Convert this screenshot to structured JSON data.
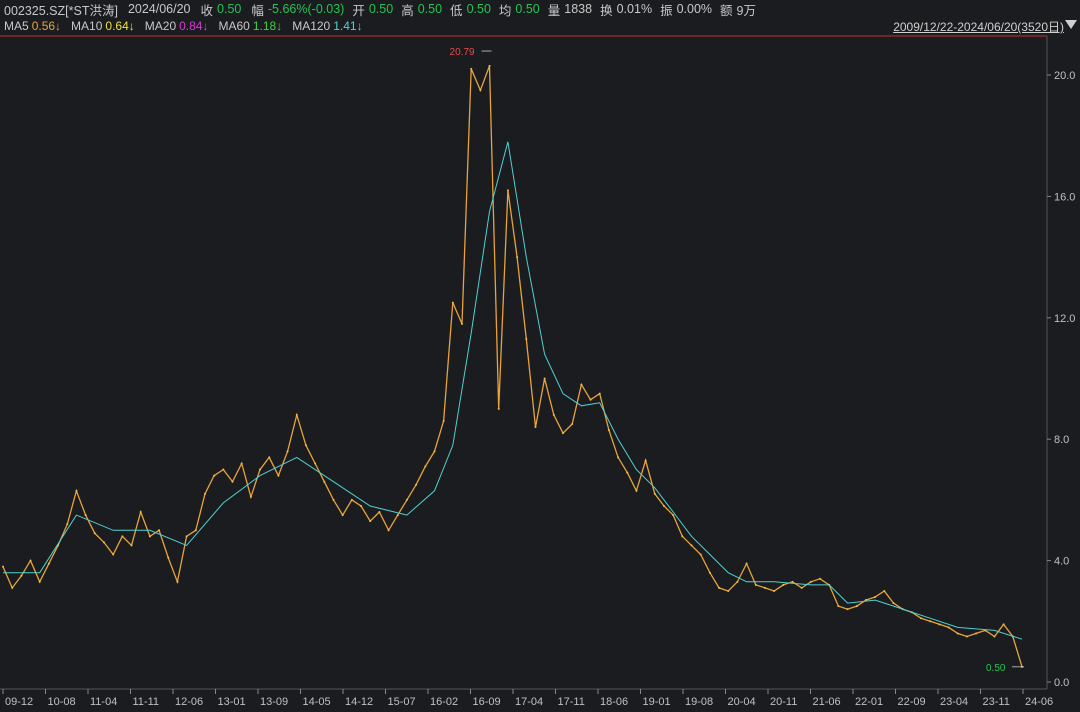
{
  "header": {
    "code": "002325.SZ[*ST洪涛]",
    "date": "2024/06/20",
    "close_label": "收",
    "close_value": "0.50",
    "change_label": "幅",
    "change_value": "-5.66%(-0.03)",
    "open_label": "开",
    "open_value": "0.50",
    "high_label": "高",
    "high_value": "0.50",
    "low_label": "低",
    "low_value": "0.50",
    "avg_label": "均",
    "avg_value": "0.50",
    "volume_label": "量",
    "volume_value": "1838",
    "turnover_label": "换",
    "turnover_value": "0.01%",
    "amplitude_label": "振",
    "amplitude_value": "0.00%",
    "amount_label": "额",
    "amount_value": "9万",
    "range_text": "2009/12/22-2024/06/20(3520日)"
  },
  "ma_legend": [
    {
      "label": "MA5",
      "value": "0.56↓",
      "color": "#e8a33a"
    },
    {
      "label": "MA10",
      "value": "0.64↓",
      "color": "#e8e13a"
    },
    {
      "label": "MA20",
      "value": "0.84↓",
      "color": "#d43bd4"
    },
    {
      "label": "MA60",
      "value": "1.18↓",
      "color": "#3fd13f"
    },
    {
      "label": "MA120",
      "value": "1.41↓",
      "color": "#4fd1d1"
    }
  ],
  "chart_data": {
    "type": "line",
    "title": "",
    "xlabel": "",
    "ylabel": "",
    "ylim": [
      0,
      20.8
    ],
    "y_ticks": [
      "20.0",
      "16.0",
      "12.0",
      "8.0",
      "4.0",
      "0.0"
    ],
    "y_tick_values": [
      20,
      16,
      12,
      8,
      4,
      0
    ],
    "x_ticks": [
      "09-12",
      "10-08",
      "11-04",
      "11-11",
      "12-06",
      "13-01",
      "13-09",
      "14-05",
      "14-12",
      "15-07",
      "16-02",
      "16-09",
      "17-04",
      "17-11",
      "18-06",
      "19-01",
      "19-08",
      "20-04",
      "20-11",
      "21-06",
      "22-01",
      "22-09",
      "23-04",
      "23-11",
      "24-06"
    ],
    "max_label": "20.79",
    "last_label": "0.50",
    "series": [
      {
        "color": "#e8a33a",
        "points": [
          [
            0,
            3.8
          ],
          [
            1,
            3.1
          ],
          [
            2,
            3.5
          ],
          [
            3,
            4.0
          ],
          [
            4,
            3.3
          ],
          [
            5,
            3.9
          ],
          [
            6,
            4.5
          ],
          [
            7,
            5.2
          ],
          [
            8,
            6.3
          ],
          [
            9,
            5.5
          ],
          [
            10,
            4.9
          ],
          [
            11,
            4.6
          ],
          [
            12,
            4.2
          ],
          [
            13,
            4.8
          ],
          [
            14,
            4.5
          ],
          [
            15,
            5.6
          ],
          [
            16,
            4.8
          ],
          [
            17,
            5.0
          ],
          [
            18,
            4.1
          ],
          [
            19,
            3.3
          ],
          [
            20,
            4.8
          ],
          [
            21,
            5.0
          ],
          [
            22,
            6.2
          ],
          [
            23,
            6.8
          ],
          [
            24,
            7.0
          ],
          [
            25,
            6.6
          ],
          [
            26,
            7.2
          ],
          [
            27,
            6.1
          ],
          [
            28,
            7.0
          ],
          [
            29,
            7.4
          ],
          [
            30,
            6.8
          ],
          [
            31,
            7.6
          ],
          [
            32,
            8.8
          ],
          [
            33,
            7.8
          ],
          [
            34,
            7.2
          ],
          [
            35,
            6.6
          ],
          [
            36,
            6.0
          ],
          [
            37,
            5.5
          ],
          [
            38,
            6.0
          ],
          [
            39,
            5.8
          ],
          [
            40,
            5.3
          ],
          [
            41,
            5.6
          ],
          [
            42,
            5.0
          ],
          [
            43,
            5.5
          ],
          [
            44,
            6.0
          ],
          [
            45,
            6.5
          ],
          [
            46,
            7.1
          ],
          [
            47,
            7.6
          ],
          [
            48,
            8.6
          ],
          [
            49,
            12.5
          ],
          [
            50,
            11.8
          ],
          [
            51,
            20.2
          ],
          [
            52,
            19.5
          ],
          [
            53,
            20.3
          ],
          [
            54,
            9.0
          ],
          [
            55,
            16.2
          ],
          [
            56,
            14.0
          ],
          [
            57,
            11.3
          ],
          [
            58,
            8.4
          ],
          [
            59,
            10.0
          ],
          [
            60,
            8.8
          ],
          [
            61,
            8.2
          ],
          [
            62,
            8.5
          ],
          [
            63,
            9.8
          ],
          [
            64,
            9.3
          ],
          [
            65,
            9.5
          ],
          [
            66,
            8.3
          ],
          [
            67,
            7.4
          ],
          [
            68,
            6.9
          ],
          [
            69,
            6.3
          ],
          [
            70,
            7.3
          ],
          [
            71,
            6.2
          ],
          [
            72,
            5.8
          ],
          [
            73,
            5.5
          ],
          [
            74,
            4.8
          ],
          [
            75,
            4.5
          ],
          [
            76,
            4.2
          ],
          [
            77,
            3.6
          ],
          [
            78,
            3.1
          ],
          [
            79,
            3.0
          ],
          [
            80,
            3.3
          ],
          [
            81,
            3.9
          ],
          [
            82,
            3.2
          ],
          [
            83,
            3.1
          ],
          [
            84,
            3.0
          ],
          [
            85,
            3.2
          ],
          [
            86,
            3.3
          ],
          [
            87,
            3.1
          ],
          [
            88,
            3.3
          ],
          [
            89,
            3.4
          ],
          [
            90,
            3.2
          ],
          [
            91,
            2.5
          ],
          [
            92,
            2.4
          ],
          [
            93,
            2.5
          ],
          [
            94,
            2.7
          ],
          [
            95,
            2.8
          ],
          [
            96,
            3.0
          ],
          [
            97,
            2.6
          ],
          [
            98,
            2.4
          ],
          [
            99,
            2.3
          ],
          [
            100,
            2.1
          ],
          [
            101,
            2.0
          ],
          [
            102,
            1.9
          ],
          [
            103,
            1.8
          ],
          [
            104,
            1.6
          ],
          [
            105,
            1.5
          ],
          [
            106,
            1.6
          ],
          [
            107,
            1.7
          ],
          [
            108,
            1.5
          ],
          [
            109,
            1.9
          ],
          [
            110,
            1.5
          ],
          [
            111,
            0.5
          ]
        ]
      },
      {
        "color": "#4fd1d1",
        "points": [
          [
            0,
            3.6
          ],
          [
            4,
            3.6
          ],
          [
            8,
            5.5
          ],
          [
            12,
            5.0
          ],
          [
            16,
            5.0
          ],
          [
            20,
            4.5
          ],
          [
            24,
            5.9
          ],
          [
            28,
            6.8
          ],
          [
            32,
            7.4
          ],
          [
            36,
            6.6
          ],
          [
            40,
            5.8
          ],
          [
            44,
            5.5
          ],
          [
            47,
            6.3
          ],
          [
            49,
            7.8
          ],
          [
            51,
            11.5
          ],
          [
            53,
            15.5
          ],
          [
            55,
            17.8
          ],
          [
            57,
            14.0
          ],
          [
            59,
            10.8
          ],
          [
            61,
            9.5
          ],
          [
            63,
            9.1
          ],
          [
            65,
            9.2
          ],
          [
            67,
            8.0
          ],
          [
            69,
            7.0
          ],
          [
            71,
            6.4
          ],
          [
            73,
            5.6
          ],
          [
            75,
            4.8
          ],
          [
            77,
            4.2
          ],
          [
            79,
            3.6
          ],
          [
            81,
            3.3
          ],
          [
            84,
            3.3
          ],
          [
            88,
            3.2
          ],
          [
            90,
            3.2
          ],
          [
            92,
            2.6
          ],
          [
            95,
            2.7
          ],
          [
            97,
            2.5
          ],
          [
            100,
            2.2
          ],
          [
            104,
            1.8
          ],
          [
            108,
            1.7
          ],
          [
            111,
            1.41
          ]
        ]
      }
    ]
  }
}
